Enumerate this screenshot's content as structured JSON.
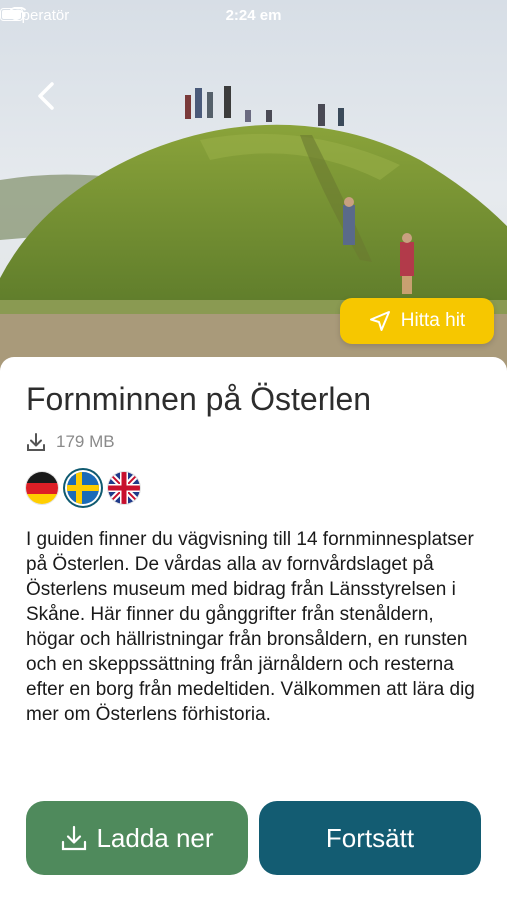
{
  "status_bar": {
    "carrier": "Operatör",
    "time": "2:24 em"
  },
  "hero": {
    "navigate_label": "Hitta hit"
  },
  "guide": {
    "title": "Fornminnen på Österlen",
    "size": "179 MB",
    "languages": [
      {
        "name": "german-flag",
        "selected": false
      },
      {
        "name": "swedish-flag",
        "selected": true
      },
      {
        "name": "uk-flag",
        "selected": false
      }
    ],
    "description": "I guiden finner du vägvisning till 14 fornminnesplatser på Österlen. De vårdas alla av fornvårdslaget på Österlens museum med bidrag från Länsstyrelsen i Skåne. Här finner du gånggrifter från stenåldern, högar och hällristningar från bronsåldern, en runsten och en skeppssättning från järnåldern och resterna efter en borg från medeltiden. Välkommen att lära dig mer om Österlens förhistoria."
  },
  "actions": {
    "download_label": "Ladda ner",
    "continue_label": "Fortsätt"
  },
  "colors": {
    "accent_yellow": "#f6c700",
    "download_green": "#4f8a5c",
    "continue_teal": "#135c72"
  }
}
